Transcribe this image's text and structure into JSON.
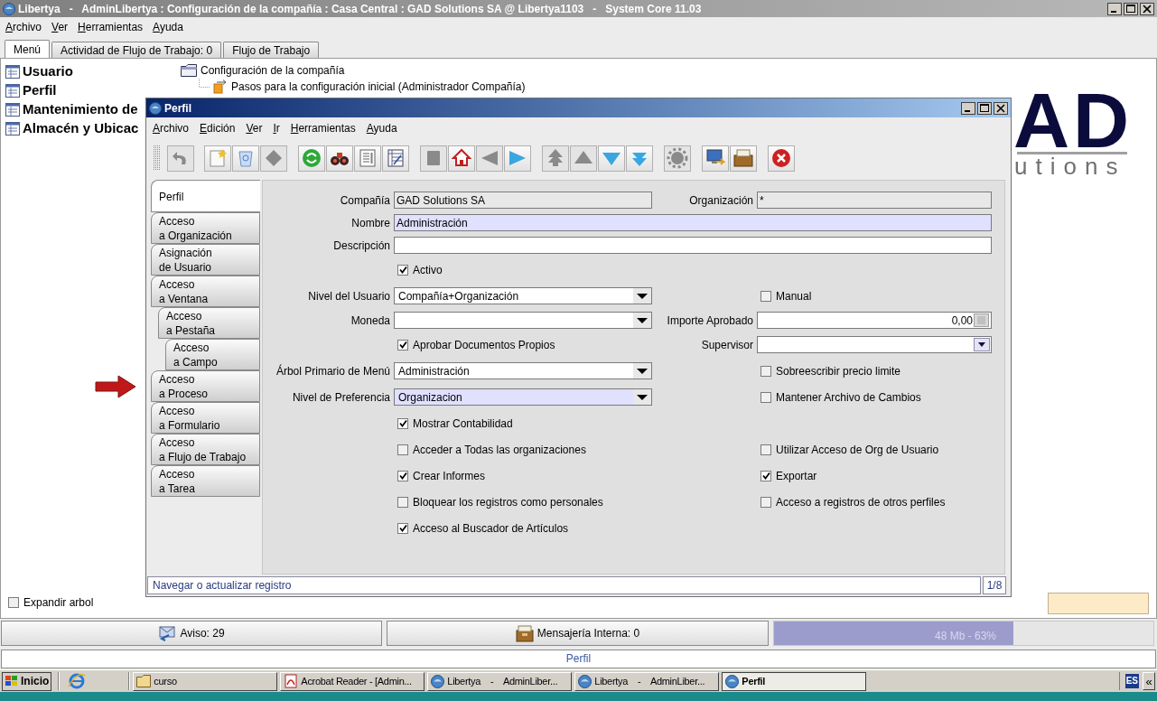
{
  "app_window": {
    "title": "Libertya   -   AdminLibertya : Configuración de la compañía : Casa Central : GAD Solutions SA @ Libertya1103   -   System Core 11.03"
  },
  "menu": [
    "Archivo",
    "Ver",
    "Herramientas",
    "Ayuda"
  ],
  "tabs": [
    {
      "label": "Menú",
      "selected": true
    },
    {
      "label": "Actividad de Flujo de Trabajo: 0",
      "selected": false
    },
    {
      "label": "Flujo de Trabajo",
      "selected": false
    }
  ],
  "favorites": [
    "Usuario",
    "Perfil",
    "Mantenimiento de",
    "Almacén y Ubicac"
  ],
  "menu_tree": [
    {
      "label": "Configuración de la compañía",
      "kind": "folder",
      "children": [
        {
          "label": "Pasos para la configuración inicial (Administrador Compañía)",
          "kind": "workflow"
        }
      ]
    }
  ],
  "logo": {
    "letters": "AD",
    "tagline": "utions"
  },
  "expand_tree": {
    "label": "Expandir arbol",
    "checked": false
  },
  "status": {
    "notices": "Aviso: 29",
    "messages": "Mensajería Interna: 0",
    "memory": {
      "reading": "48 Mb - 63%",
      "level": 0.63
    }
  },
  "footer": "Perfil",
  "perfil_window": {
    "title": "Perfil",
    "menu": [
      "Archivo",
      "Edición",
      "Ver",
      "Ir",
      "Herramientas",
      "Ayuda"
    ],
    "toolbar": [
      {
        "disabled": true
      },
      {
        "disabled": false
      },
      {
        "disabled": false
      },
      {
        "disabled": true
      },
      {
        "disabled": false
      },
      {
        "disabled": false
      },
      {
        "disabled": false
      },
      {
        "disabled": false
      },
      {
        "disabled": true
      },
      {
        "disabled": false
      },
      {
        "disabled": true
      },
      {
        "disabled": false
      },
      {
        "disabled": true
      },
      {
        "disabled": true
      },
      {
        "disabled": false
      },
      {
        "disabled": false
      },
      {
        "disabled": true
      },
      {
        "disabled": false
      },
      {
        "disabled": false
      },
      {
        "disabled": false
      }
    ],
    "tabs": [
      {
        "label": "Perfil",
        "selected": true
      },
      {
        "label": "Acceso\na Organización",
        "selected": false
      },
      {
        "label": "Asignación\nde Usuario",
        "selected": false
      },
      {
        "label": "Acceso\na Ventana",
        "selected": false,
        "children": [
          {
            "label": "Acceso\na Pestaña",
            "selected": false,
            "children": [
              {
                "label": "Acceso\na Campo",
                "selected": false
              }
            ]
          }
        ]
      },
      {
        "label": "Acceso\na Proceso",
        "selected": false
      },
      {
        "label": "Acceso\na Formulario",
        "selected": false
      },
      {
        "label": "Acceso\na Flujo de Trabajo",
        "selected": false
      },
      {
        "label": "Acceso\na Tarea",
        "selected": false
      }
    ],
    "form": {
      "rows": [
        {
          "left": {
            "kind": "field",
            "label": "Compañía",
            "value": "GAD Solutions SA",
            "readonly": true
          },
          "right": {
            "kind": "field",
            "label": "Organización",
            "value": "*",
            "readonly": true
          }
        },
        {
          "full": {
            "kind": "field",
            "label": "Nombre",
            "value": "Administración",
            "readonly": false,
            "mandatory": true
          }
        },
        {
          "full": {
            "kind": "field",
            "label": "Descripción",
            "readonly": false,
            "mandatory": false
          }
        },
        {
          "left": {
            "kind": "checkbox",
            "label": "Activo",
            "checked": true
          }
        },
        {
          "left": {
            "kind": "combo",
            "label": "Nivel del Usuario",
            "value": "Compañía+Organización",
            "readonly": false,
            "mandatory": false
          },
          "right": {
            "kind": "checkbox",
            "label": "Manual",
            "checked": false
          }
        },
        {
          "left": {
            "kind": "combo",
            "label": "Moneda",
            "readonly": false,
            "mandatory": false
          },
          "right": {
            "kind": "number",
            "label": "Importe Aprobado",
            "value": "0,00",
            "readonly": false,
            "mandatory": false
          }
        },
        {
          "left": {
            "kind": "checkbox",
            "label": "Aprobar Documentos Propios",
            "checked": true
          },
          "right": {
            "kind": "lookup",
            "label": "Supervisor",
            "readonly": false,
            "mandatory": false
          }
        },
        {
          "left": {
            "kind": "combo",
            "label": "Árbol Primario de Menú",
            "value": "Administración",
            "readonly": false,
            "mandatory": false
          },
          "right": {
            "kind": "checkbox",
            "label": "Sobreescribir precio limite",
            "checked": false
          }
        },
        {
          "left": {
            "kind": "combo",
            "label": "Nivel de Preferencia",
            "value": "Organizacion",
            "readonly": false,
            "mandatory": true
          },
          "right": {
            "kind": "checkbox",
            "label": "Mantener Archivo de Cambios",
            "checked": false
          }
        },
        {
          "left": {
            "kind": "checkbox",
            "label": "Mostrar Contabilidad",
            "checked": true
          }
        },
        {
          "left": {
            "kind": "checkbox",
            "label": "Acceder a Todas las organizaciones",
            "checked": false
          },
          "right": {
            "kind": "checkbox",
            "label": "Utilizar Acceso de Org de Usuario",
            "checked": false
          }
        },
        {
          "left": {
            "kind": "checkbox",
            "label": "Crear Informes",
            "checked": true
          },
          "right": {
            "kind": "checkbox",
            "label": "Exportar",
            "checked": true
          }
        },
        {
          "left": {
            "kind": "checkbox",
            "label": "Bloquear los registros como personales",
            "checked": false
          },
          "right": {
            "kind": "checkbox",
            "label": "Acceso a registros de otros perfiles",
            "checked": false
          }
        },
        {
          "left": {
            "kind": "checkbox",
            "label": "Acceso al Buscador de Artículos",
            "checked": true
          }
        }
      ]
    },
    "status_bar": {
      "message": "Navegar o actualizar registro",
      "record": "1/8"
    }
  },
  "taskbar": {
    "start": "Inicio",
    "items": [
      {
        "label": "curso",
        "kind": "folder",
        "selected": false
      },
      {
        "label": "Acrobat Reader - [Admin...",
        "kind": "pdf",
        "selected": false
      },
      {
        "label": "Libertya    -    AdminLiber...",
        "kind": "app",
        "selected": false
      },
      {
        "label": "Libertya    -    AdminLiber...",
        "kind": "app",
        "selected": false
      },
      {
        "label": "Perfil",
        "kind": "app",
        "selected": true
      }
    ],
    "language": "ES",
    "collapse": "«"
  }
}
